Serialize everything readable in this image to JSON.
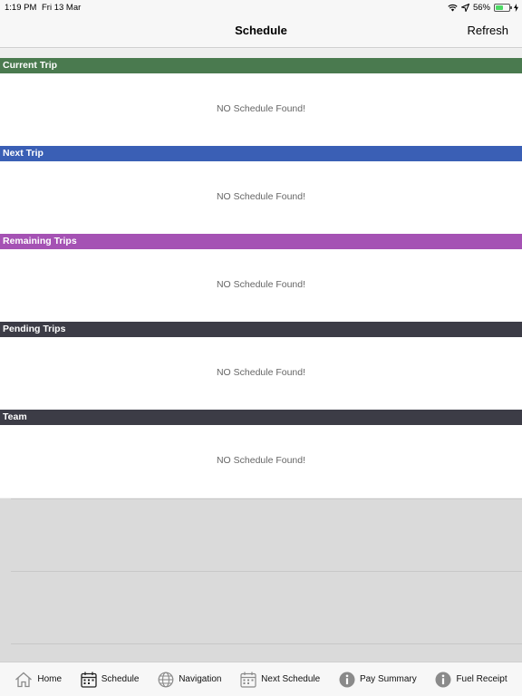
{
  "status": {
    "time": "1:19 PM",
    "date": "Fri 13 Mar",
    "battery": "56%",
    "battery_level": 0.56
  },
  "header": {
    "title": "Schedule",
    "refresh_label": "Refresh"
  },
  "sections": [
    {
      "title": "Current Trip",
      "color": "#4a7a4f",
      "empty_text": "NO Schedule Found!"
    },
    {
      "title": "Next Trip",
      "color": "#3a5fb5",
      "empty_text": "NO Schedule Found!"
    },
    {
      "title": "Remaining Trips",
      "color": "#a552b4",
      "empty_text": "NO Schedule Found!"
    },
    {
      "title": "Pending Trips",
      "color": "#3c3c46",
      "empty_text": "NO Schedule Found!"
    },
    {
      "title": "Team",
      "color": "#3c3c46",
      "empty_text": "NO Schedule Found!"
    }
  ],
  "tabs": [
    {
      "label": "Home",
      "icon": "home-icon"
    },
    {
      "label": "Schedule",
      "icon": "calendar-icon"
    },
    {
      "label": "Navigation",
      "icon": "globe-icon"
    },
    {
      "label": "Next Schedule",
      "icon": "calendar-icon"
    },
    {
      "label": "Pay Summary",
      "icon": "info-icon"
    },
    {
      "label": "Fuel Receipt",
      "icon": "info-icon"
    }
  ]
}
